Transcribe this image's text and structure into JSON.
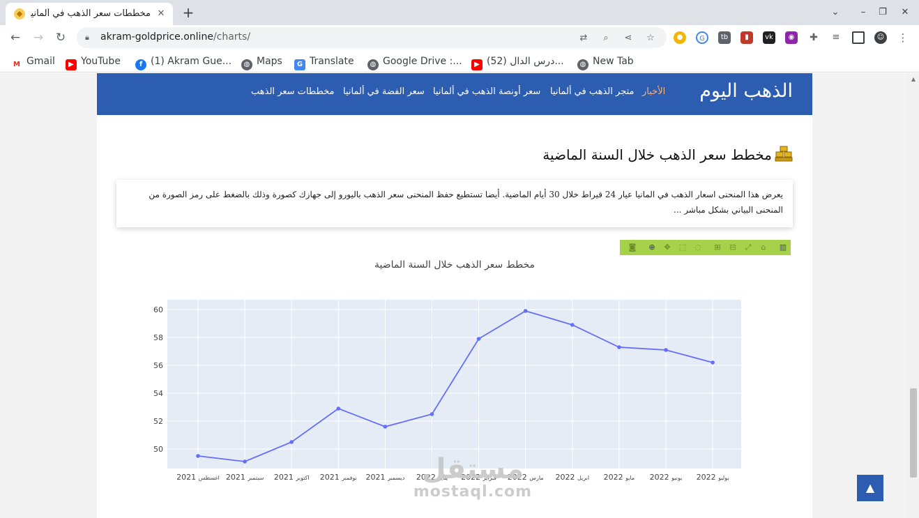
{
  "browser": {
    "tab_title": "مخططات سعر الذهب في ألمانيا",
    "new_tab_symbol": "+",
    "url_host": "akram-goldprice.online",
    "url_path": "/charts/",
    "bookmarks": [
      {
        "label": "Gmail",
        "icon": "gmail-icon",
        "color": "#d93025"
      },
      {
        "label": "YouTube",
        "icon": "youtube-icon",
        "color": "#ff0000"
      },
      {
        "label": "(1) Akram Gue...",
        "icon": "facebook-icon",
        "color": "#1877f2"
      },
      {
        "label": "Maps",
        "icon": "globe-icon",
        "color": "#5f6368"
      },
      {
        "label": "Translate",
        "icon": "translate-icon",
        "color": "#4285f4"
      },
      {
        "label": "Google Drive :...",
        "icon": "globe-icon",
        "color": "#5f6368"
      },
      {
        "label": "(52) درس الدال...",
        "icon": "youtube-icon",
        "color": "#ff0000"
      },
      {
        "label": "New Tab",
        "icon": "globe-icon",
        "color": "#5f6368"
      }
    ]
  },
  "site": {
    "brand": "الذهب اليوم",
    "nav": [
      {
        "label": "الأخبار",
        "active": true
      },
      {
        "label": "متجر الذهب في ألمانيا",
        "active": false
      },
      {
        "label": "سعر أونصة الذهب في ألمانيا",
        "active": false
      },
      {
        "label": "سعر الفضة في ألمانيا",
        "active": false
      },
      {
        "label": "مخططات سعر الذهب",
        "active": false
      }
    ],
    "heading": "مخطط سعر الذهب خلال السنة الماضية",
    "description": "يعرض هذا المنحنى اسعار الذهب في المانيا عيار 24 قيراط خلال 30 أيام الماضية. أيضا تستطيع حفظ المنحنى سعر الذهب باليورو إلى جهازك كصورة وذلك بالضغط على رمز الصورة من المنحنى البياني بشكل مباشر ...",
    "watermark_ar": "مستقل",
    "watermark_lat": "mostaql.com",
    "scroll_top_symbol": "▲"
  },
  "chart_data": {
    "type": "line",
    "title": "مخطط سعر الذهب خلال السنة الماضية",
    "xlabel": "",
    "ylabel": "",
    "categories": [
      "اغسطس 2021",
      "سبتمبر 2021",
      "اكتوبر 2021",
      "نوفمبر 2021",
      "ديسمبر 2021",
      "يناير 2022",
      "فبراير 2022",
      "مارس 2022",
      "ابريل 2022",
      "مايو 2022",
      "يونيو 2022",
      "يوليو 2022"
    ],
    "tick_labels": [
      {
        "month": "اغسطس",
        "year": "2021"
      },
      {
        "month": "سبتمبر",
        "year": "2021"
      },
      {
        "month": "اكتوبر",
        "year": "2021"
      },
      {
        "month": "نوفمبر",
        "year": "2021"
      },
      {
        "month": "ديسمبر",
        "year": "2021"
      },
      {
        "month": "يناير",
        "year": "2022"
      },
      {
        "month": "فبراير",
        "year": "2022"
      },
      {
        "month": "مارس",
        "year": "2022"
      },
      {
        "month": "ابريل",
        "year": "2022"
      },
      {
        "month": "مايو",
        "year": "2022"
      },
      {
        "month": "يونيو",
        "year": "2022"
      },
      {
        "month": "يوليو",
        "year": "2022"
      }
    ],
    "values": [
      49.5,
      49.1,
      50.5,
      52.9,
      51.6,
      52.5,
      57.9,
      59.9,
      58.9,
      57.3,
      57.1,
      56.2
    ],
    "ylim": [
      48.6,
      60.7
    ],
    "yticks": [
      50,
      52,
      54,
      56,
      58,
      60
    ],
    "grid": true,
    "line_color": "#636efa",
    "plot_bg": "#e5ecf6"
  }
}
